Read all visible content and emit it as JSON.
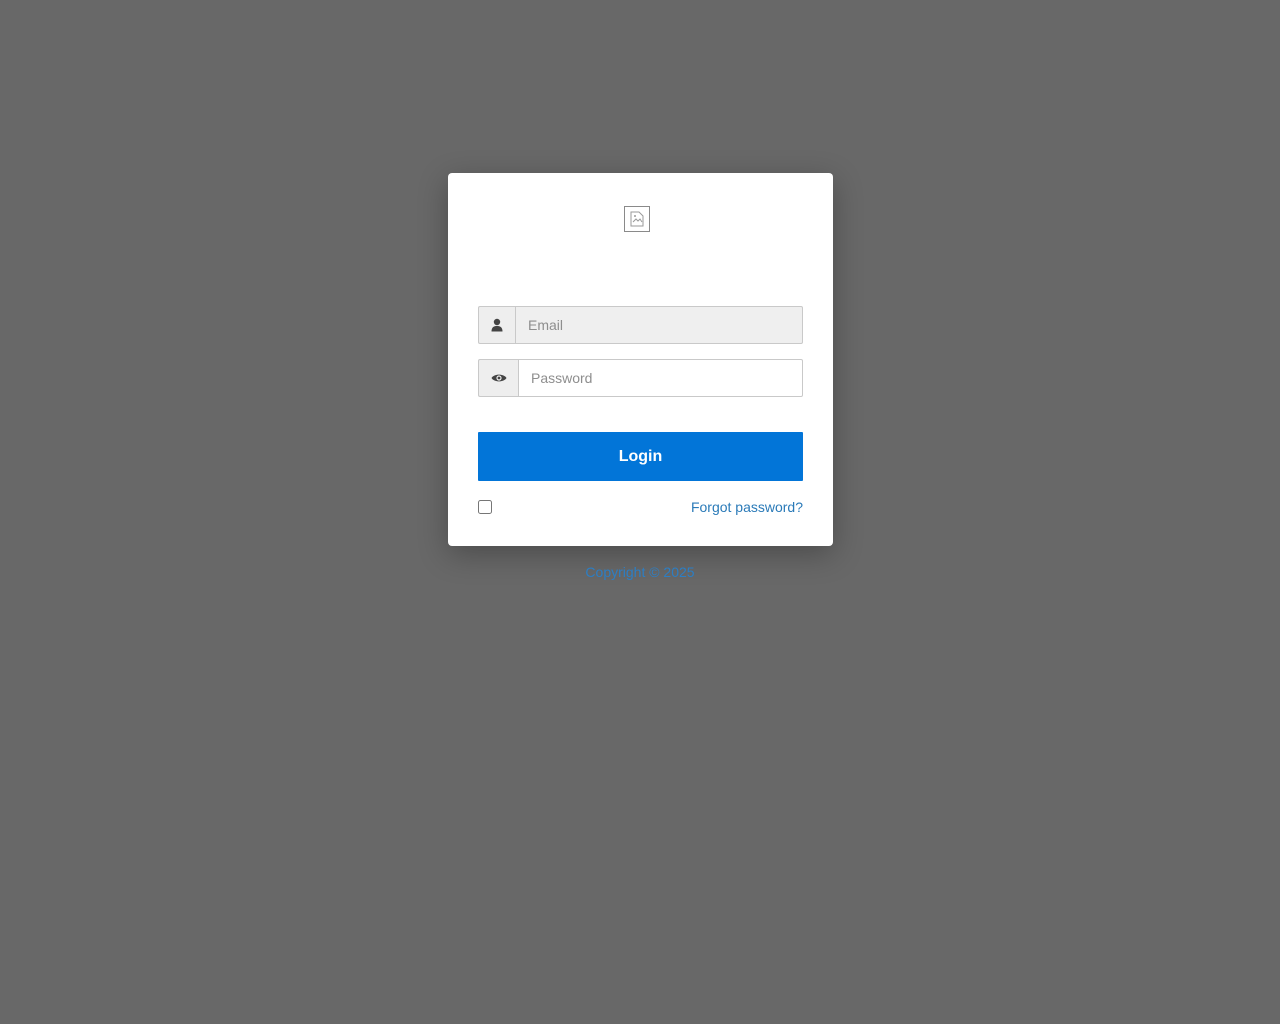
{
  "logo": {
    "icon": "broken-image-icon"
  },
  "email": {
    "placeholder": "Email",
    "value": "",
    "icon": "user-icon"
  },
  "password": {
    "placeholder": "Password",
    "value": "",
    "icon": "eye-icon"
  },
  "login_button": {
    "label": "Login"
  },
  "remember": {
    "checked": false
  },
  "forgot_link": {
    "label": "Forgot password?"
  },
  "footer": {
    "copyright": "Copyright © 2025"
  },
  "colors": {
    "background": "#686868",
    "primary": "#0275d8",
    "link": "#2a7ab8"
  }
}
